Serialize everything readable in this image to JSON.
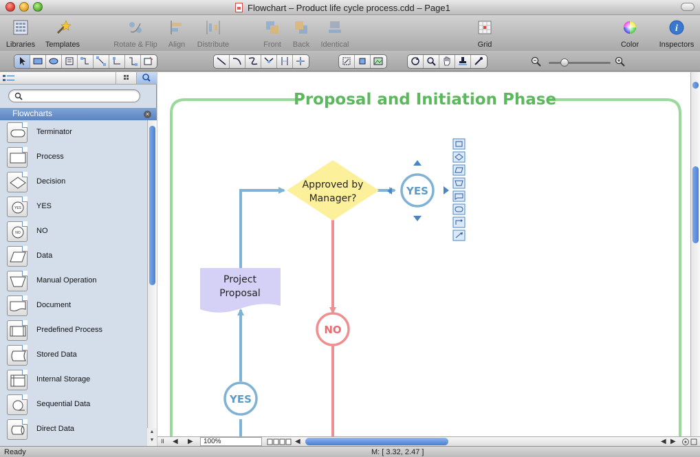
{
  "window": {
    "title": "Flowchart – Product life cycle process.cdd – Page1"
  },
  "toolbar": {
    "libraries": "Libraries",
    "templates": "Templates",
    "rotate_flip": "Rotate & Flip",
    "align": "Align",
    "distribute": "Distribute",
    "front": "Front",
    "back": "Back",
    "identical": "Identical",
    "grid": "Grid",
    "color": "Color",
    "inspectors": "Inspectors"
  },
  "sidebar": {
    "section_title": "Flowcharts",
    "search_placeholder": "",
    "items": [
      {
        "label": "Terminator",
        "icon": "terminator-shape-icon"
      },
      {
        "label": "Process",
        "icon": "process-shape-icon"
      },
      {
        "label": "Decision",
        "icon": "decision-shape-icon"
      },
      {
        "label": "YES",
        "icon": "yes-shape-icon"
      },
      {
        "label": "NO",
        "icon": "no-shape-icon"
      },
      {
        "label": "Data",
        "icon": "data-shape-icon"
      },
      {
        "label": "Manual Operation",
        "icon": "manual-operation-shape-icon"
      },
      {
        "label": "Document",
        "icon": "document-shape-icon"
      },
      {
        "label": "Predefined Process",
        "icon": "predefined-process-shape-icon"
      },
      {
        "label": "Stored Data",
        "icon": "stored-data-shape-icon"
      },
      {
        "label": "Internal Storage",
        "icon": "internal-storage-shape-icon"
      },
      {
        "label": "Sequential Data",
        "icon": "sequential-data-shape-icon"
      },
      {
        "label": "Direct Data",
        "icon": "direct-data-shape-icon"
      }
    ]
  },
  "diagram": {
    "phase_title": "Proposal and Initiation Phase",
    "decision_line1": "Approved by",
    "decision_line2": "Manager?",
    "yes_label": "YES",
    "no_label": "NO",
    "document_line1": "Project",
    "document_line2": "Proposal",
    "yes_bottom_label": "YES",
    "colors": {
      "phase_green": "#5cb85c",
      "frame_green": "#9bd89b",
      "decision_yellow": "#fdf09a",
      "connector_blue": "#7fb3d5",
      "no_red": "#ee8f92",
      "document_purple": "#d5d0f5"
    }
  },
  "bottom": {
    "zoom": "100%"
  },
  "status": {
    "left": "Ready",
    "coords": "M: [ 3.32, 2.47 ]"
  }
}
